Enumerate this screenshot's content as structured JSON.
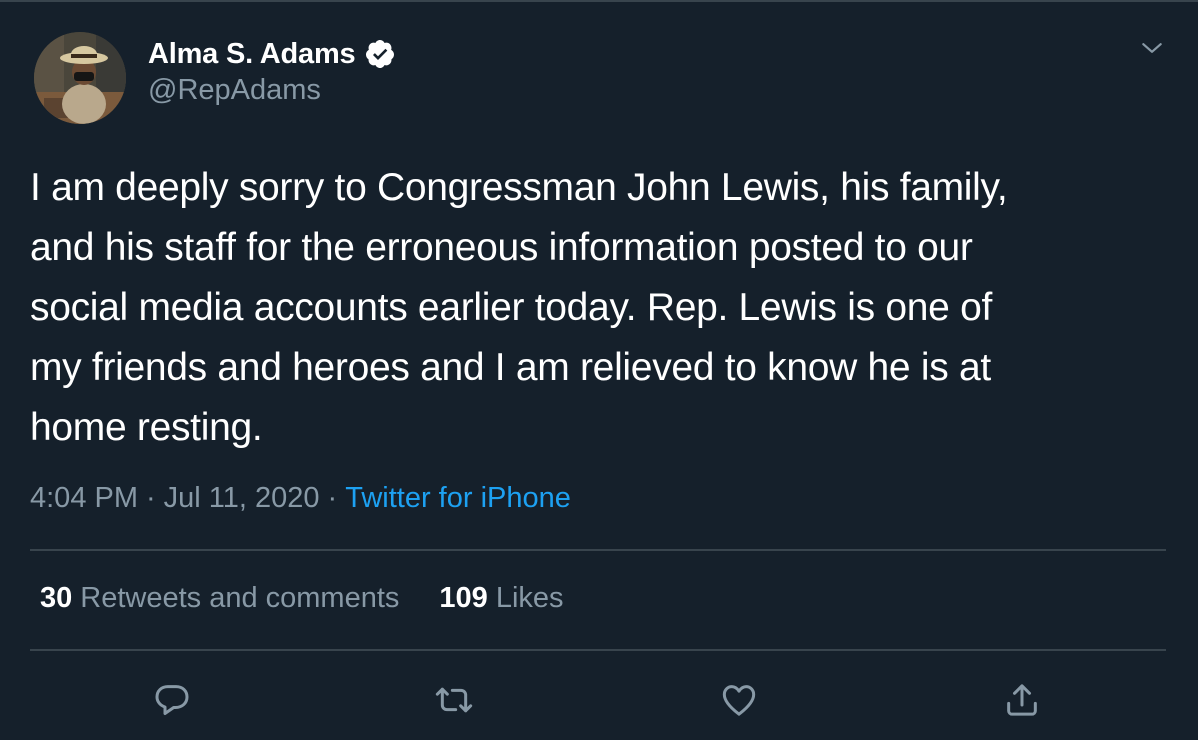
{
  "author": {
    "display_name": "Alma S. Adams",
    "handle": "@RepAdams",
    "verified": true
  },
  "tweet": {
    "text": "I am deeply sorry to Congressman John Lewis, his family,\nand his staff for the erroneous information posted to our\nsocial media accounts earlier today. Rep. Lewis is one of\nmy friends and heroes and I am relieved to know he is at\nhome resting.",
    "time": "4:04 PM",
    "date": "Jul 11, 2020",
    "separator": "·",
    "source": "Twitter for iPhone"
  },
  "stats": {
    "retweets_count": "30",
    "retweets_label": "Retweets and comments",
    "likes_count": "109",
    "likes_label": "Likes"
  },
  "icons": {
    "reply": "reply-icon",
    "retweet": "retweet-icon",
    "like": "like-icon",
    "share": "share-icon",
    "caret": "chevron-down-icon",
    "verified": "verified-badge-icon"
  },
  "colors": {
    "background": "#15202b",
    "text": "#ffffff",
    "secondary": "#8899a6",
    "accent": "#1da1f2",
    "divider": "#38444d"
  }
}
